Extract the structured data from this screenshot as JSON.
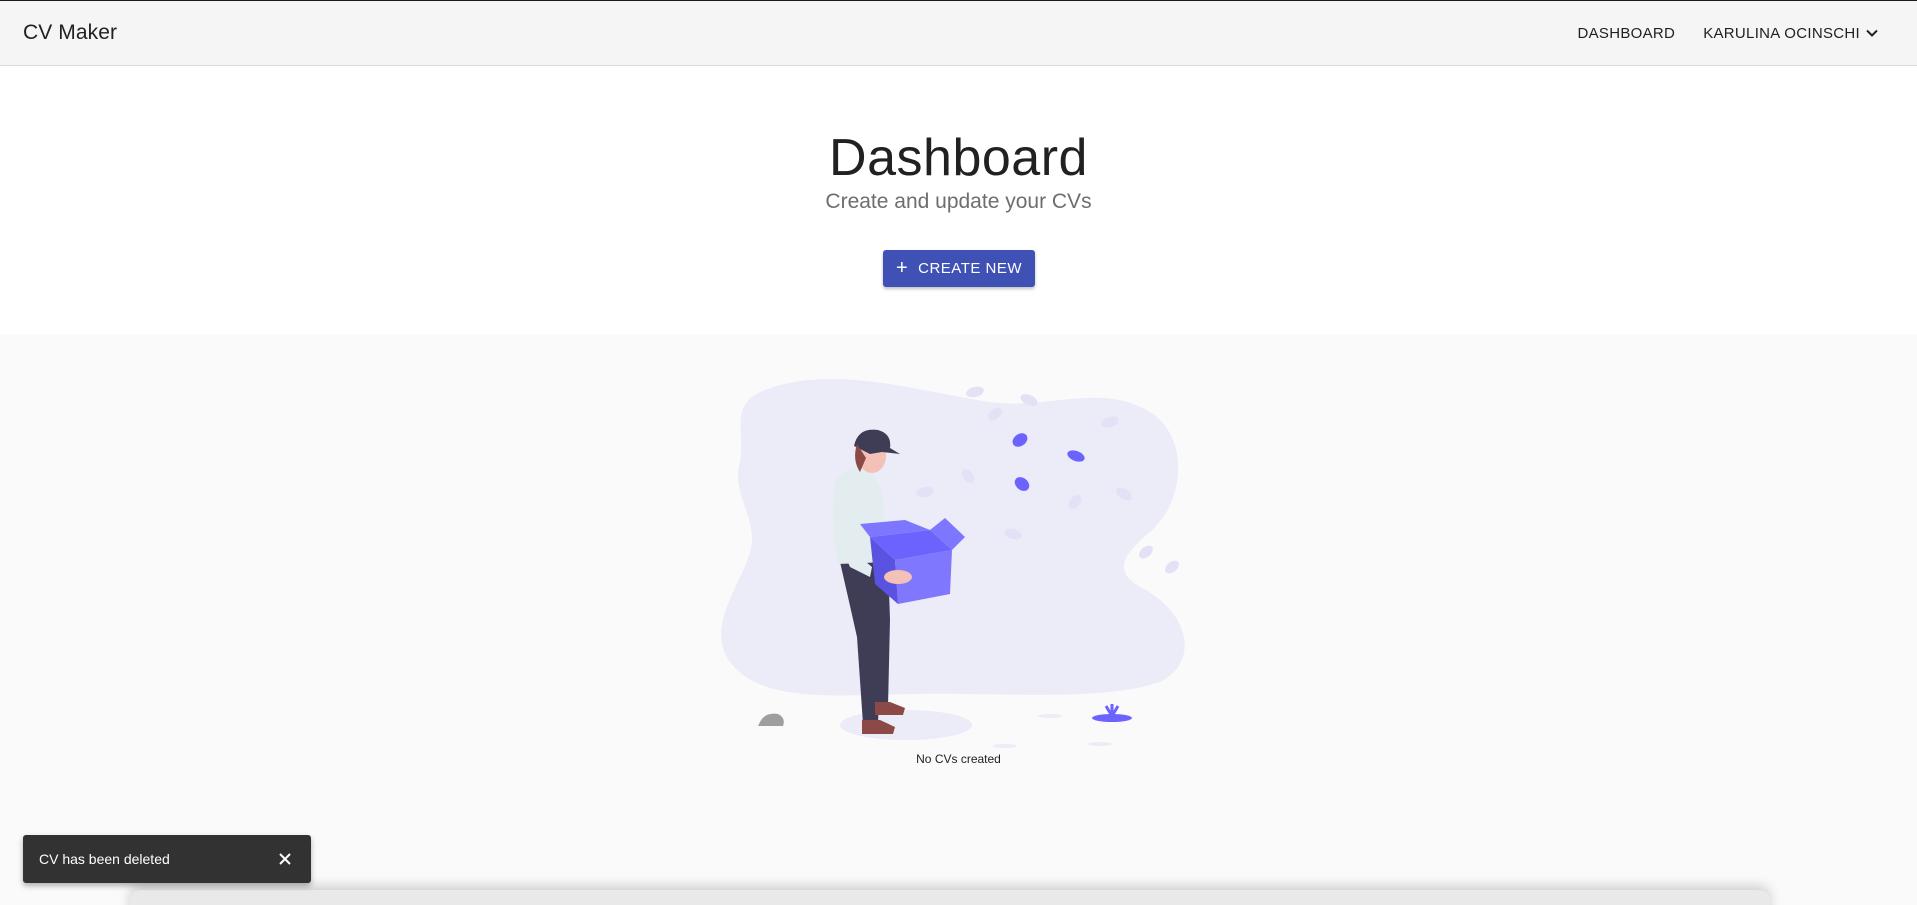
{
  "app": {
    "brand": "CV Maker"
  },
  "nav": {
    "dashboard_label": "DASHBOARD",
    "user_name": "KARULINA OCINSCHI",
    "user_icon": "chevron-down-icon"
  },
  "hero": {
    "title": "Dashboard",
    "subtitle": "Create and update your CVs",
    "create_button_label": "CREATE NEW",
    "create_button_icon": "plus-icon"
  },
  "empty_state": {
    "message": "No CVs created",
    "illustration": "person-holding-empty-box-illustration"
  },
  "snackbar": {
    "message": "CV has been deleted",
    "close_icon": "close-icon"
  },
  "colors": {
    "primary": "#3f51b5",
    "illustration_accent": "#6c63ff",
    "illustration_blob": "#ecebf8",
    "snackbar_bg": "#323232"
  }
}
